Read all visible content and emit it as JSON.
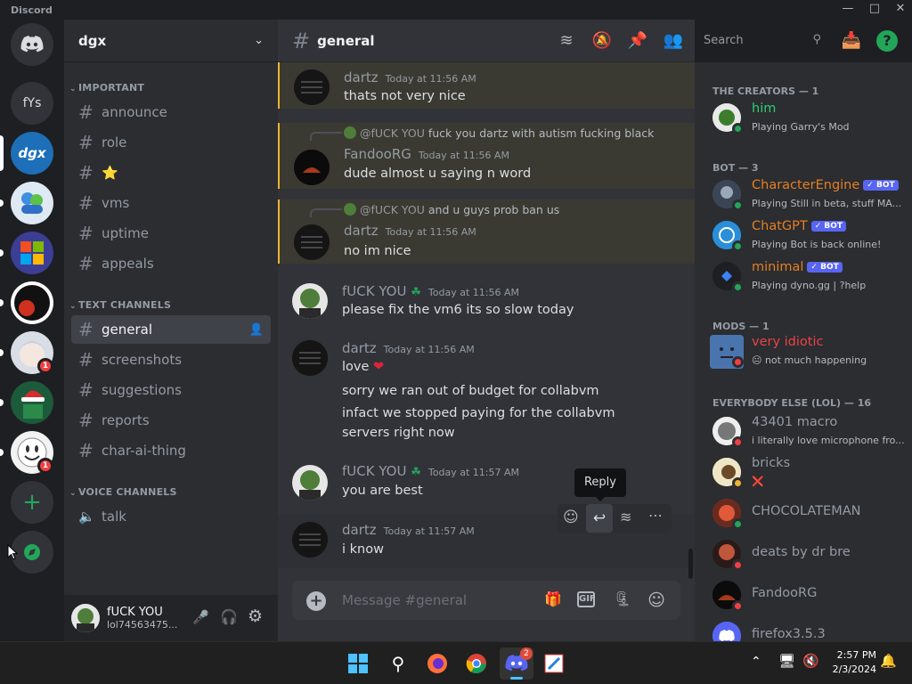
{
  "window": {
    "title": "Discord"
  },
  "servers": [
    {
      "name": "Direct Messages",
      "icon": "discord-logo-icon"
    },
    {
      "name": "fYs",
      "label": "fYs"
    },
    {
      "name": "dgx",
      "label": "dgx"
    },
    {
      "name": "server-msn",
      "icon": "msn-icon"
    },
    {
      "name": "server-windows",
      "icon": "windows-logo-icon"
    },
    {
      "name": "server-red-black",
      "icon": "server-icon"
    },
    {
      "name": "server-anime",
      "icon": "server-icon",
      "badge": "1"
    },
    {
      "name": "server-christmas",
      "icon": "server-icon"
    },
    {
      "name": "server-smiley",
      "icon": "server-icon",
      "badge": "1"
    }
  ],
  "guild": {
    "name": "dgx"
  },
  "categories": {
    "important": "IMPORTANT",
    "text": "TEXT CHANNELS",
    "voice": "VOICE CHANNELS"
  },
  "important_channels": [
    "announce",
    "role",
    "⭐",
    "vms",
    "uptime",
    "appeals"
  ],
  "text_channels": [
    "general",
    "screenshots",
    "suggestions",
    "reports",
    "char-ai-thing"
  ],
  "voice_channels": [
    "talk"
  ],
  "user": {
    "name": "fUCK YOU",
    "tag": "lol74563475..."
  },
  "chat": {
    "channel": "general",
    "search_placeholder": "Search",
    "composer_placeholder": "Message #general",
    "tooltip": "Reply",
    "messages": [
      {
        "author": "dartz",
        "time": "Today at 11:56 AM",
        "text": "thats not very nice",
        "mention": true
      },
      {
        "reply_to": "@fUCK YOU",
        "reply_text": "fuck you dartz with autism fucking black",
        "author": "FandooRG",
        "time": "Today at 11:56 AM",
        "text": "dude almost u saying n word",
        "mention": true
      },
      {
        "reply_to": "@fUCK YOU",
        "reply_text": "and u guys prob ban us",
        "author": "dartz",
        "time": "Today at 11:56 AM",
        "text": "no im nice",
        "mention": true
      },
      {
        "author": "fUCK YOU",
        "time": "Today at 11:56 AM",
        "text": "please fix the vm6 its so slow today"
      },
      {
        "author": "dartz",
        "time": "Today at 11:56 AM",
        "text": "love",
        "extra": [
          "sorry we ran out of budget for collabvm",
          "infact we stopped paying for the collabvm",
          "servers right now"
        ]
      },
      {
        "author": "fUCK YOU",
        "time": "Today at 11:57 AM",
        "text": "you are best"
      },
      {
        "author": "dartz",
        "time": "Today at 11:57 AM",
        "text": "i know"
      }
    ]
  },
  "members": {
    "groups": [
      {
        "label": "THE CREATORS — 1",
        "items": [
          {
            "name": "him",
            "activity": "Playing Garry's Mod",
            "status": "online",
            "color": "#3ba55c"
          }
        ]
      },
      {
        "label": "BOT — 3",
        "items": [
          {
            "name": "CharacterEngine",
            "activity": "Playing Still in beta, stuff MA...",
            "status": "online",
            "color": "#e67e22",
            "bot": "BOT"
          },
          {
            "name": "ChatGPT",
            "activity": "Playing Bot is back online!",
            "status": "online",
            "color": "#e67e22",
            "bot": "BOT"
          },
          {
            "name": "minimal",
            "activity": "Playing dyno.gg | ?help",
            "status": "online",
            "color": "#e67e22",
            "bot": "BOT"
          }
        ]
      },
      {
        "label": "MODS — 1",
        "items": [
          {
            "name": "very idiotic",
            "activity": "😐 not much happening",
            "status": "dnd",
            "color": "#ed4245"
          }
        ]
      },
      {
        "label": "EVERYBODY ELSE (LOL) — 16",
        "items": [
          {
            "name": "43401 macro",
            "activity": "i literally love microphone fro...",
            "status": "dnd",
            "color": "#949ba4"
          },
          {
            "name": "bricks",
            "activity": "❌",
            "status": "idle",
            "color": "#949ba4"
          },
          {
            "name": "CHOCOLATEMAN",
            "activity": "",
            "status": "online",
            "color": "#949ba4"
          },
          {
            "name": "deats by dr bre",
            "activity": "",
            "status": "dnd",
            "color": "#949ba4"
          },
          {
            "name": "FandooRG",
            "activity": "",
            "status": "dnd",
            "color": "#949ba4"
          },
          {
            "name": "firefox3.5.3",
            "activity": "",
            "status": "online",
            "color": "#949ba4"
          }
        ]
      }
    ]
  },
  "taskbar": {
    "time": "2:57 PM",
    "date": "2/3/2024",
    "discord_badge": "2"
  },
  "colors": {
    "accent": "#5865f2",
    "online": "#23a55a",
    "dnd": "#f23f43",
    "idle": "#f0b232"
  }
}
